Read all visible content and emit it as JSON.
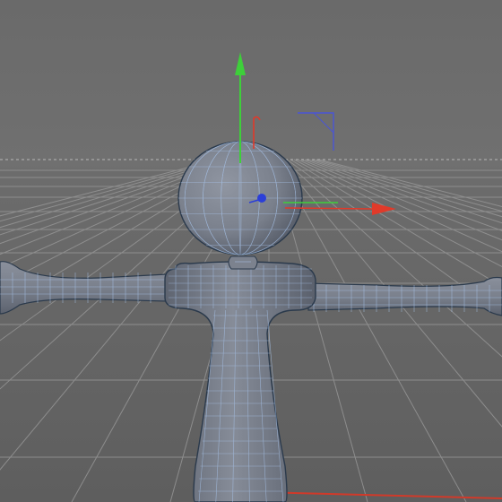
{
  "viewport": {
    "label": "",
    "colors": {
      "background": "#6c6c6c",
      "grid_line": "#9a9a9a",
      "horizon": "#b4b4b4",
      "mesh_fill": "#7a808c",
      "mesh_edge": "#a9c6ee",
      "mesh_outline": "#2b3a4c",
      "axis_x": "#e03a2a",
      "axis_y": "#3ecf3a",
      "axis_z": "#2b3fd8",
      "guide": "#4a55d6"
    },
    "icons": {
      "gizmo_x": "move-x-arrow-icon",
      "gizmo_y": "move-y-arrow-icon",
      "gizmo_z": "move-z-handle-icon",
      "rotate": "rotate-handle-icon",
      "corner": "view-corner-guide-icon"
    }
  }
}
